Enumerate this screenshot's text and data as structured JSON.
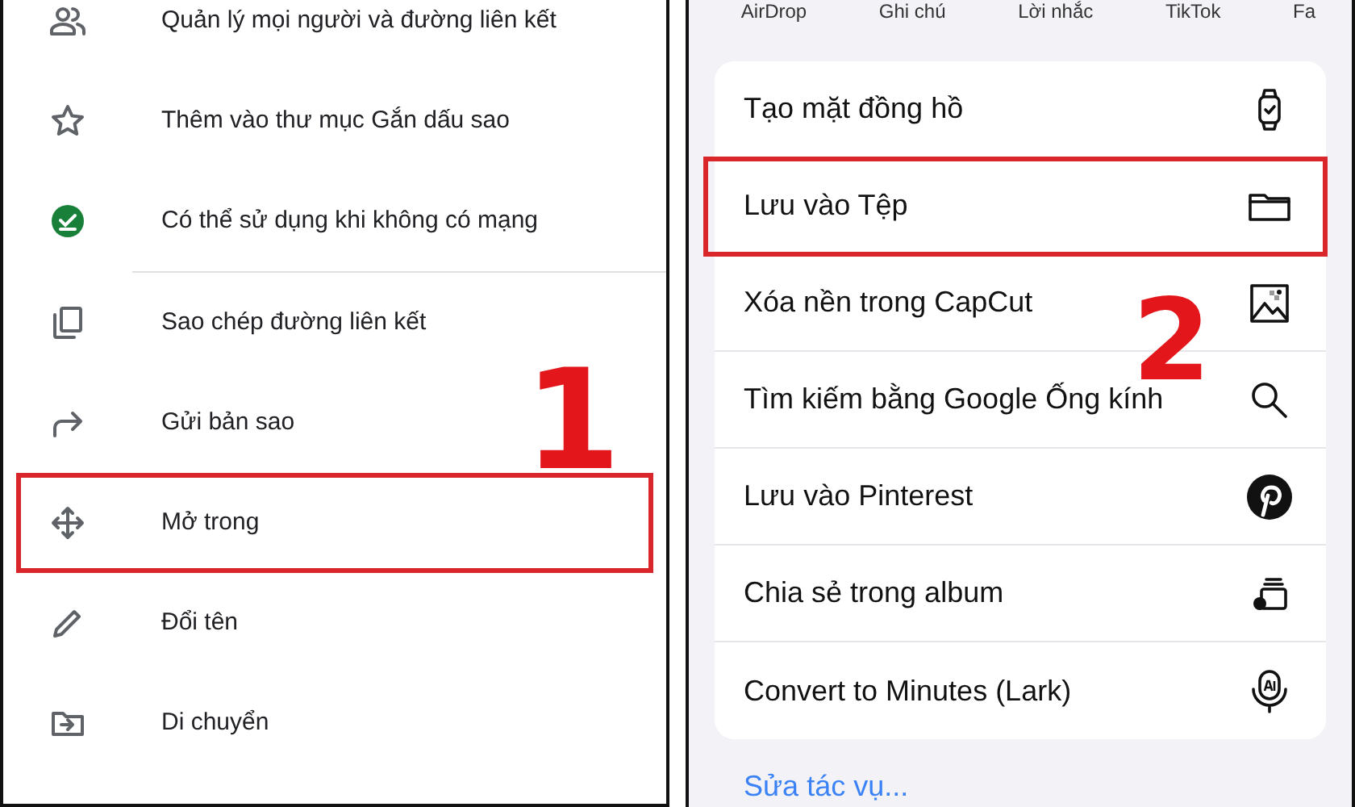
{
  "left_panel": {
    "items": [
      {
        "label": "Quản lý mọi người và đường liên kết",
        "highlighted": false
      },
      {
        "label": "Thêm vào thư mục Gắn dấu sao",
        "highlighted": false
      },
      {
        "label": "Có thể sử dụng khi không có mạng",
        "highlighted": false,
        "divider_after": true
      },
      {
        "label": "Sao chép đường liên kết",
        "highlighted": false
      },
      {
        "label": "Gửi bản sao",
        "highlighted": false
      },
      {
        "label": "Mở trong",
        "highlighted": true
      },
      {
        "label": "Đổi tên",
        "highlighted": false
      },
      {
        "label": "Di chuyển",
        "highlighted": false
      }
    ],
    "step_number": "1"
  },
  "right_panel": {
    "apps": [
      "AirDrop",
      "Ghi chú",
      "Lời nhắc",
      "TikTok",
      "Fa"
    ],
    "actions": [
      {
        "label": "Tạo mặt đồng hồ",
        "highlighted": false
      },
      {
        "label": "Lưu vào Tệp",
        "highlighted": true
      },
      {
        "label": "Xóa nền trong CapCut",
        "highlighted": false
      },
      {
        "label": "Tìm kiếm bằng Google Ống kính",
        "highlighted": false
      },
      {
        "label": "Lưu vào Pinterest",
        "highlighted": false
      },
      {
        "label": "Chia sẻ trong album",
        "highlighted": false
      },
      {
        "label": "Convert to Minutes (Lark)",
        "highlighted": false
      }
    ],
    "edit_link": "Sửa tác vụ...",
    "step_number": "2"
  }
}
